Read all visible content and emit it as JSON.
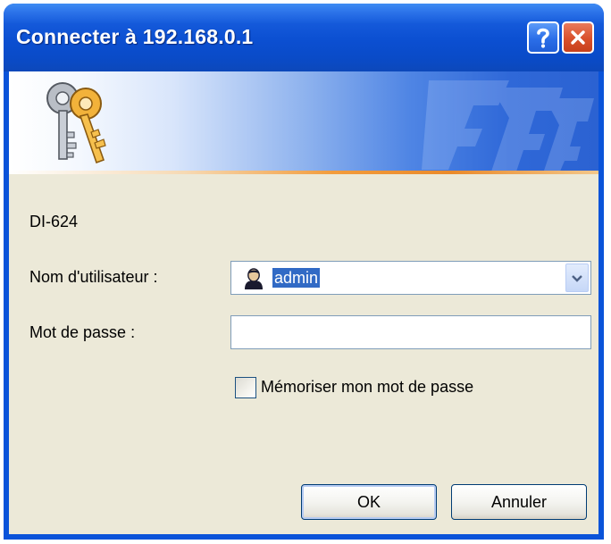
{
  "window": {
    "title": "Connecter à 192.168.0.1",
    "help_icon": "question-mark-icon",
    "close_icon": "x-close-icon"
  },
  "banner": {
    "icon": "keys-icon"
  },
  "form": {
    "realm": "DI-624",
    "username_label": "Nom d'utilisateur :",
    "username_value": "admin",
    "username_icon": "user-icon",
    "dropdown_icon": "chevron-down-icon",
    "password_label": "Mot de passe :",
    "password_value": "",
    "remember_label": "Mémoriser mon mot de passe",
    "remember_checked": false
  },
  "buttons": {
    "ok_label": "OK",
    "cancel_label": "Annuler"
  },
  "colors": {
    "titlebar": "#0a4bc8",
    "client_bg": "#ece9d8",
    "selection": "#316ac5",
    "close_button": "#d9502b",
    "banner_accent": "#f29c3c"
  }
}
